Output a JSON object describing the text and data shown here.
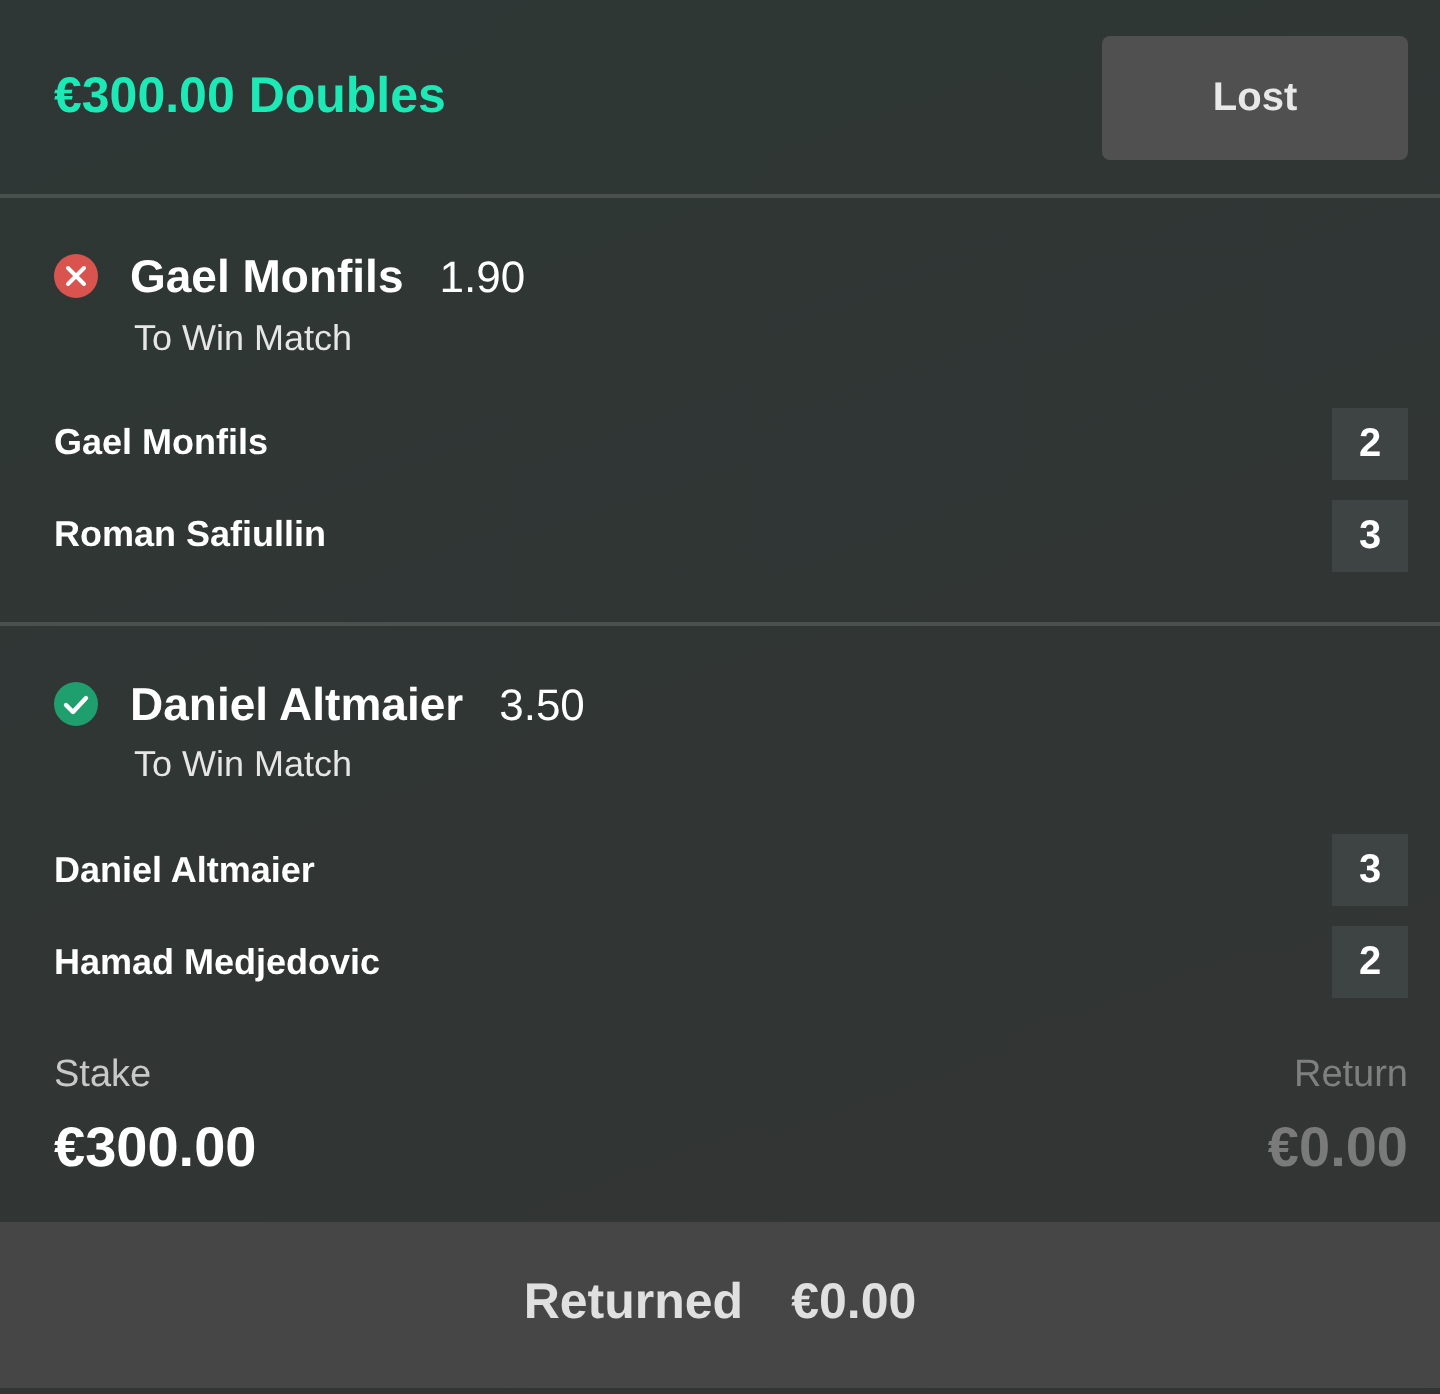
{
  "header": {
    "title": "€300.00 Doubles",
    "status": "Lost"
  },
  "selections": [
    {
      "won": false,
      "name": "Gael Monfils",
      "odds": "1.90",
      "market": "To Win Match",
      "players": [
        {
          "name": "Gael Monfils",
          "score": "2"
        },
        {
          "name": "Roman Safiullin",
          "score": "3"
        }
      ]
    },
    {
      "won": true,
      "name": "Daniel Altmaier",
      "odds": "3.50",
      "market": "To Win Match",
      "players": [
        {
          "name": "Daniel Altmaier",
          "score": "3"
        },
        {
          "name": "Hamad Medjedovic",
          "score": "2"
        }
      ]
    }
  ],
  "stake": {
    "label": "Stake",
    "value": "€300.00"
  },
  "return": {
    "label": "Return",
    "value": "€0.00"
  },
  "footer": {
    "label": "Returned",
    "value": "€0.00"
  }
}
